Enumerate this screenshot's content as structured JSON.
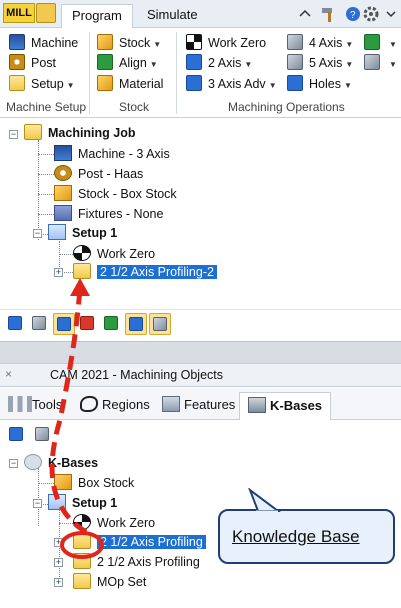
{
  "ribbon": {
    "app_badge": "MILL",
    "tabs": [
      "Program",
      "Simulate"
    ],
    "groups": {
      "machine_setup": {
        "label": "Machine Setup",
        "items": [
          "Machine",
          "Post",
          "Setup"
        ]
      },
      "stock": {
        "label": "Stock",
        "items": [
          "Stock",
          "Align",
          "Material"
        ]
      },
      "machining_operations": {
        "label": "Machining Operations",
        "items": [
          "Work Zero",
          "2 Axis",
          "3 Axis Adv",
          "4 Axis",
          "5 Axis",
          "Holes"
        ]
      }
    }
  },
  "job_tree": {
    "root": "Machining Job",
    "items": [
      "Machine - 3 Axis",
      "Post - Haas",
      "Stock - Box Stock",
      "Fixtures - None"
    ],
    "setup": "Setup 1",
    "setup_children": [
      "Work Zero",
      "2 1/2 Axis Profiling-2"
    ]
  },
  "objects_panel": {
    "title": "CAM 2021 - Machining Objects",
    "tabs": [
      "Tools",
      "Regions",
      "Features",
      "K-Bases"
    ],
    "tree": {
      "root": "K-Bases",
      "items": [
        "Box Stock"
      ],
      "setup": "Setup 1",
      "setup_children": [
        "Work Zero",
        "2 1/2 Axis Profiling",
        "2 1/2 Axis Profiling",
        "MOp Set"
      ]
    }
  },
  "callout": {
    "text": "Knowledge Base"
  },
  "colors": {
    "selection": "#1e6fd2",
    "arrow": "#e0261b",
    "callout_border": "#1f3f74"
  }
}
